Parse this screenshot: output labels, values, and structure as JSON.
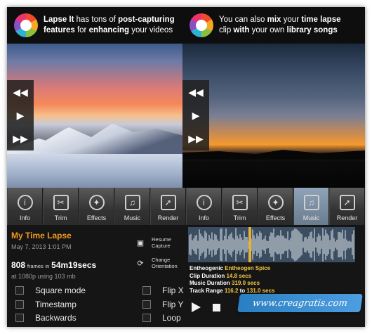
{
  "headers": {
    "left": {
      "t1": "Lapse It",
      "t2": " has tons of ",
      "t3": "post-capturing",
      "t4": "features",
      "t5": " for ",
      "t6": "enhancing",
      "t7": " your videos"
    },
    "right": {
      "t1": "You can also ",
      "t2": "mix",
      "t3": " your ",
      "t4": "time lapse",
      "t5": "clip",
      "t6": " with ",
      "t7": "your own ",
      "t8": "library songs"
    }
  },
  "toolbar": [
    {
      "label": "Info",
      "icon": "info-icon"
    },
    {
      "label": "Trim",
      "icon": "scissors-icon"
    },
    {
      "label": "Effects",
      "icon": "effects-icon"
    },
    {
      "label": "Music",
      "icon": "music-icon"
    },
    {
      "label": "Render",
      "icon": "render-icon"
    },
    {
      "label": "Info",
      "icon": "info-icon"
    },
    {
      "label": "Trim",
      "icon": "scissors-icon"
    },
    {
      "label": "Effects",
      "icon": "effects-icon"
    },
    {
      "label": "Music",
      "icon": "music-icon",
      "active": true
    },
    {
      "label": "Render",
      "icon": "render-icon"
    }
  ],
  "info": {
    "title": "My Time Lapse",
    "date": "May 7, 2013 1:01 PM",
    "frames_count": "808",
    "frames_word": "frames",
    "in_word": "in",
    "duration": "54m19secs",
    "resolution": "at 1080p using 103 mb",
    "resume": "Resume",
    "capture": "Capture",
    "change": "Change",
    "orientation": "Orientation",
    "options": {
      "square_mode": "Square mode",
      "timestamp": "Timestamp",
      "backwards": "Backwards",
      "flip_x": "Flip X",
      "flip_y": "Flip Y",
      "loop": "Loop"
    }
  },
  "music": {
    "artist_label": "Entheogenic",
    "track": "Entheogen Spice",
    "clip_label": "Clip Duration",
    "clip_value": "14.8 secs",
    "music_label": "Music Duration",
    "music_value": "319.0 secs",
    "range_label": "Track Range",
    "range_from": "116.2",
    "range_to_word": "to",
    "range_to": "131.0 secs"
  },
  "watermark": "www.creagratis.com"
}
